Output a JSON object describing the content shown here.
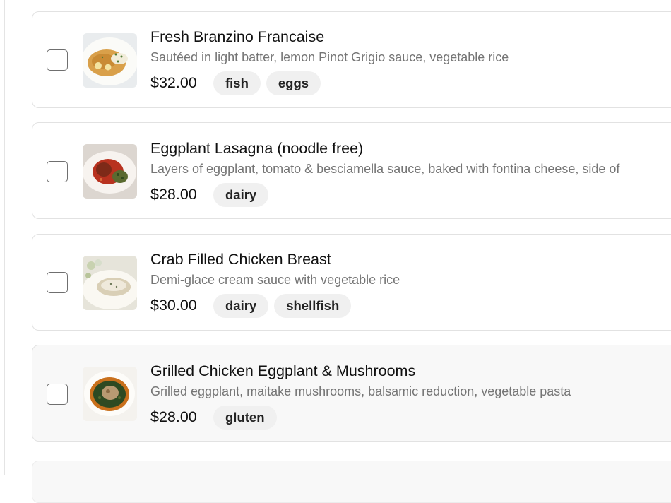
{
  "menu_items": [
    {
      "name": "Fresh Branzino Francaise",
      "description": "Sautéed in light batter, lemon Pinot Grigio sauce, vegetable rice",
      "price": "$32.00",
      "tags": [
        "fish",
        "eggs"
      ],
      "image_icon": "branzino-plate-image"
    },
    {
      "name": "Eggplant Lasagna (noodle free)",
      "description": "Layers of eggplant, tomato & besciamella sauce, baked with fontina cheese, side of",
      "price": "$28.00",
      "tags": [
        "dairy"
      ],
      "image_icon": "lasagna-plate-image"
    },
    {
      "name": "Crab Filled Chicken Breast",
      "description": "Demi-glace cream sauce with vegetable rice",
      "price": "$30.00",
      "tags": [
        "dairy",
        "shellfish"
      ],
      "image_icon": "chicken-plate-image"
    },
    {
      "name": "Grilled Chicken Eggplant & Mushrooms",
      "description": "Grilled eggplant, maitake mushrooms, balsamic reduction, vegetable pasta",
      "price": "$28.00",
      "tags": [
        "gluten"
      ],
      "image_icon": "grilled-chicken-plate-image"
    }
  ]
}
